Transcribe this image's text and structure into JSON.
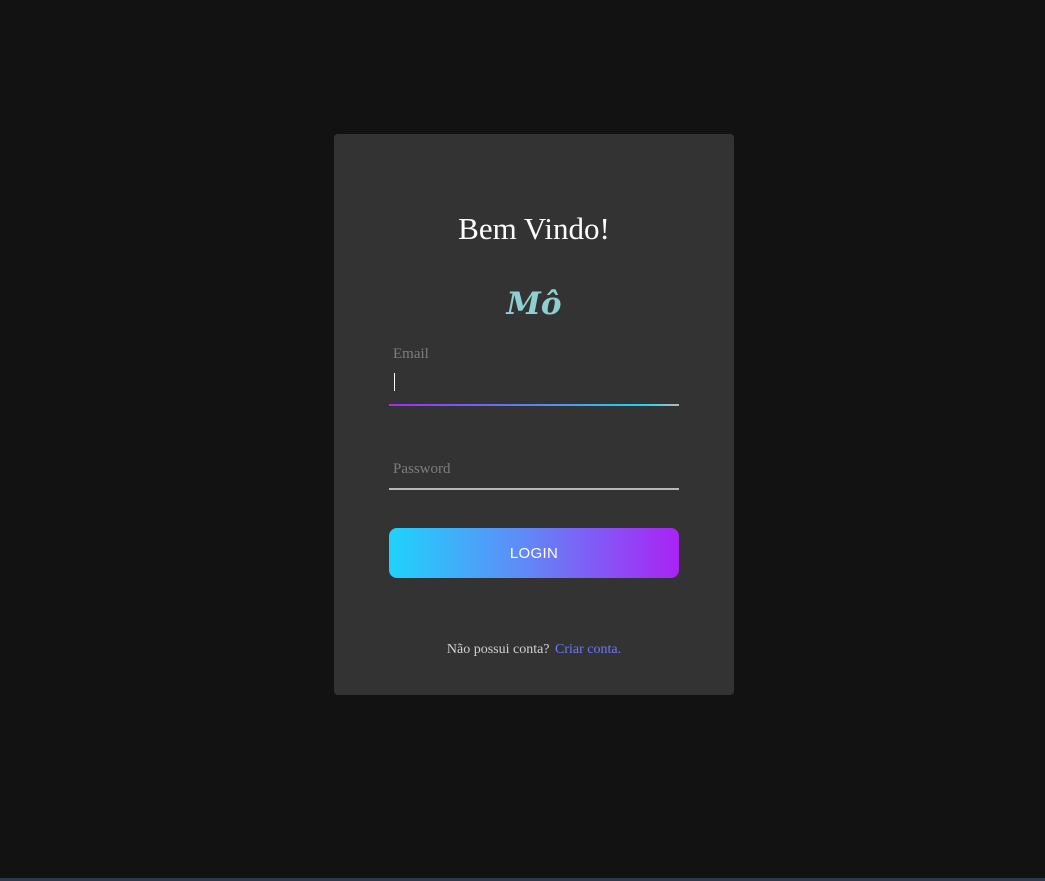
{
  "card": {
    "title": "Bem Vindo!",
    "logo": "Mô"
  },
  "form": {
    "email": {
      "label": "Email",
      "value": ""
    },
    "password": {
      "label": "Password",
      "value": ""
    },
    "login_label": "LOGIN"
  },
  "footer": {
    "prompt": "Não possui conta?",
    "link_label": "Criar conta."
  },
  "colors": {
    "background": "#121212",
    "card": "#333333",
    "logo": "#8fcfd2",
    "gradient_start": "#1fd3fb",
    "gradient_end": "#a923f4",
    "link": "#6e78f7"
  }
}
